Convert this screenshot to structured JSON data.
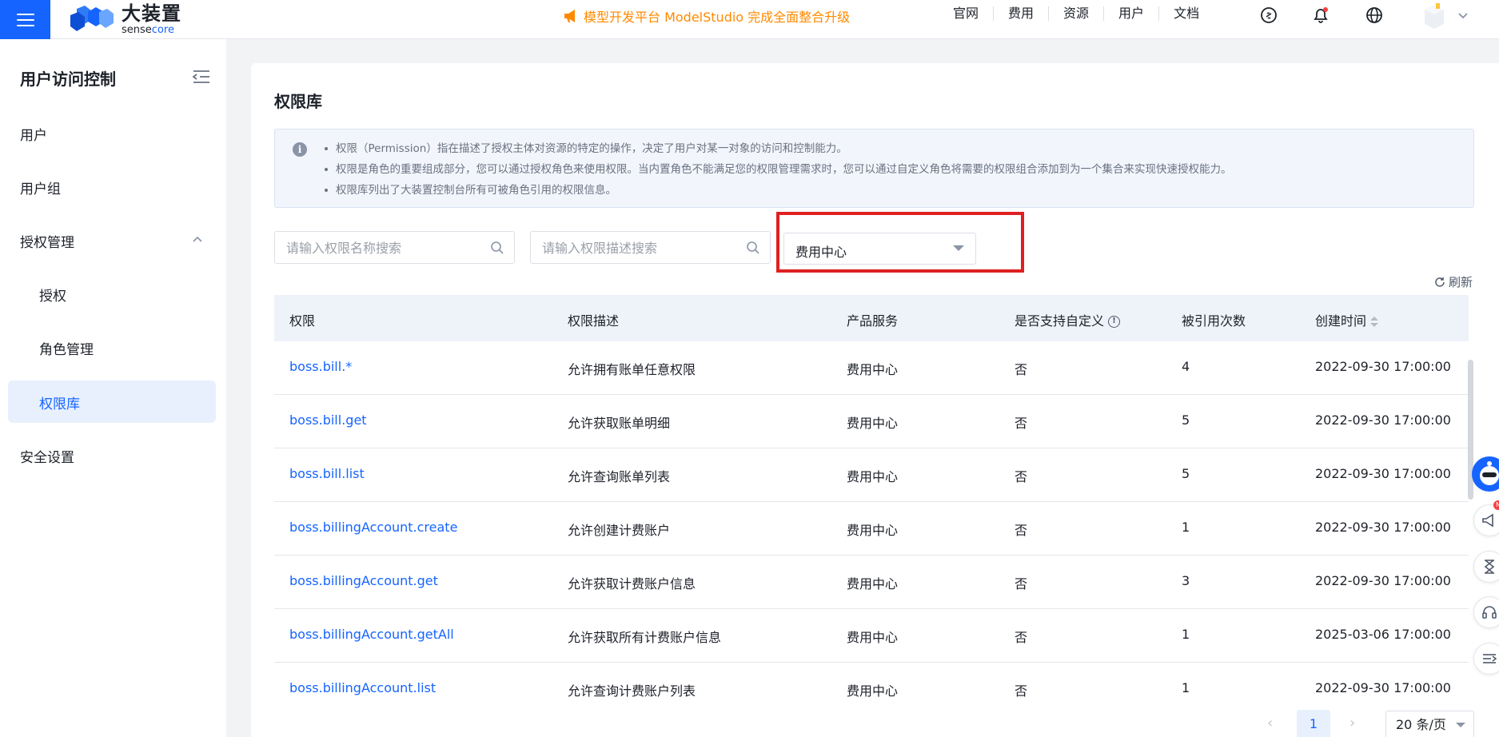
{
  "topbar": {
    "logo_cn": "大装置",
    "logo_en_a": "sense",
    "logo_en_b": "core",
    "announcement": "模型开发平台 ModelStudio 完成全面整合升级",
    "nav": [
      "官网",
      "费用",
      "资源",
      "用户",
      "文档"
    ]
  },
  "sidebar": {
    "title": "用户访问控制",
    "items": [
      {
        "label": "用户"
      },
      {
        "label": "用户组"
      },
      {
        "label": "授权管理"
      },
      {
        "label": "授权"
      },
      {
        "label": "角色管理"
      },
      {
        "label": "权限库"
      },
      {
        "label": "安全设置"
      }
    ]
  },
  "main": {
    "title": "权限库",
    "info": [
      "权限（Permission）指在描述了授权主体对资源的特定的操作，决定了用户对某一对象的访问和控制能力。",
      "权限是角色的重要组成部分，您可以通过授权角色来使用权限。当内置角色不能满足您的权限管理需求时，您可以通过自定义角色将需要的权限组合添加到为一个集合来实现快速授权能力。",
      "权限库列出了大装置控制台所有可被角色引用的权限信息。"
    ],
    "search_name_placeholder": "请输入权限名称搜索",
    "search_desc_placeholder": "请输入权限描述搜索",
    "product_filter": "费用中心",
    "refresh_label": "刷新",
    "columns": [
      "权限",
      "权限描述",
      "产品服务",
      "是否支持自定义",
      "被引用次数",
      "创建时间"
    ],
    "rows": [
      {
        "perm": "boss.bill.*",
        "desc": "允许拥有账单任意权限",
        "product": "费用中心",
        "custom": "否",
        "refs": "4",
        "created": "2022-09-30 17:00:00"
      },
      {
        "perm": "boss.bill.get",
        "desc": "允许获取账单明细",
        "product": "费用中心",
        "custom": "否",
        "refs": "5",
        "created": "2022-09-30 17:00:00"
      },
      {
        "perm": "boss.bill.list",
        "desc": "允许查询账单列表",
        "product": "费用中心",
        "custom": "否",
        "refs": "5",
        "created": "2022-09-30 17:00:00"
      },
      {
        "perm": "boss.billingAccount.create",
        "desc": "允许创建计费账户",
        "product": "费用中心",
        "custom": "否",
        "refs": "1",
        "created": "2022-09-30 17:00:00"
      },
      {
        "perm": "boss.billingAccount.get",
        "desc": "允许获取计费账户信息",
        "product": "费用中心",
        "custom": "否",
        "refs": "3",
        "created": "2022-09-30 17:00:00"
      },
      {
        "perm": "boss.billingAccount.getAll",
        "desc": "允许获取所有计费账户信息",
        "product": "费用中心",
        "custom": "否",
        "refs": "1",
        "created": "2025-03-06 17:00:00"
      },
      {
        "perm": "boss.billingAccount.list",
        "desc": "允许查询计费账户列表",
        "product": "费用中心",
        "custom": "否",
        "refs": "1",
        "created": "2022-09-30 17:00:00"
      }
    ],
    "pagination": {
      "current": "1",
      "page_size": "20 条/页"
    }
  },
  "colors": {
    "accent": "#1664ff",
    "announcement": "#ff8a00",
    "highlight": "#e02020"
  }
}
